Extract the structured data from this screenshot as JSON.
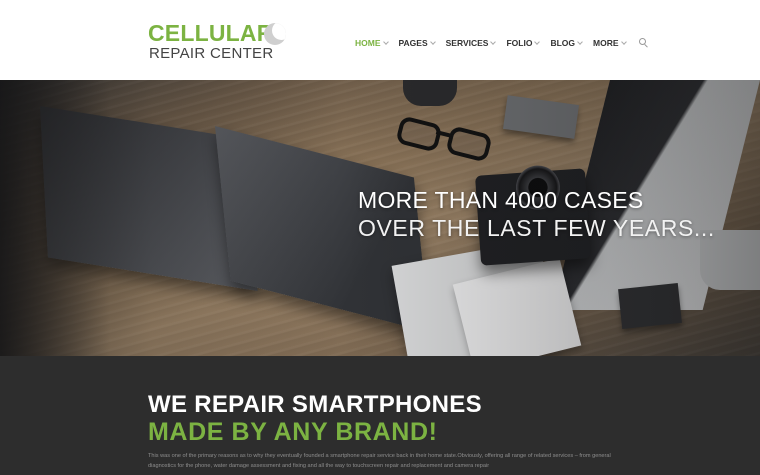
{
  "logo": {
    "title": "CELLULAR",
    "subtitle": "REPAIR CENTER"
  },
  "nav": {
    "items": [
      {
        "label": "HOME",
        "active": true
      },
      {
        "label": "PAGES",
        "active": false
      },
      {
        "label": "SERVICES",
        "active": false
      },
      {
        "label": "FOLIO",
        "active": false
      },
      {
        "label": "BLOG",
        "active": false
      },
      {
        "label": "MORE",
        "active": false
      }
    ],
    "search_icon": "search-icon"
  },
  "hero": {
    "line1": "MORE THAN 4000 CASES",
    "line2": "OVER THE LAST FEW YEARS..."
  },
  "about": {
    "title": "WE REPAIR SMARTPHONES",
    "subtitle": "MADE BY ANY BRAND!",
    "paragraph": "This was one of the primary reasons as to why they eventually founded a smartphone repair service back in their home state.Obviously, offering all range of related services – from general diagnostics for the phone, water damage assessment and fixing and all the way to touchscreen repair and replacement and camera repair"
  },
  "colors": {
    "accent": "#7cb342",
    "dark_bg": "#2d2d2d",
    "text_dark": "#333333"
  }
}
